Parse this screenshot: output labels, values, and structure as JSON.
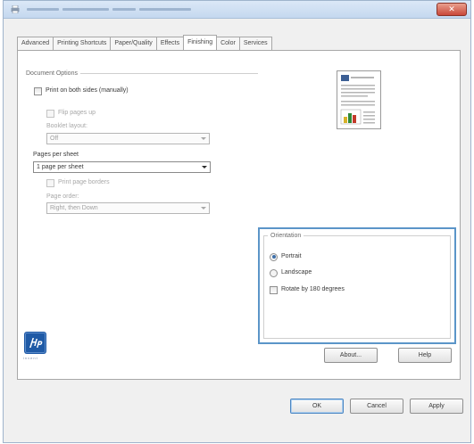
{
  "window": {
    "tabs": [
      {
        "label": "Advanced"
      },
      {
        "label": "Printing Shortcuts"
      },
      {
        "label": "Paper/Quality"
      },
      {
        "label": "Effects"
      },
      {
        "label": "Finishing"
      },
      {
        "label": "Color"
      },
      {
        "label": "Services"
      }
    ],
    "active_tab": "Finishing"
  },
  "document_options": {
    "legend": "Document Options",
    "print_both_sides": "Print on both sides (manually)",
    "flip_pages_up": "Flip pages up",
    "booklet_layout_label": "Booklet layout:",
    "booklet_layout_value": "Off",
    "pages_per_sheet_label": "Pages per sheet",
    "pages_per_sheet_value": "1 page per sheet",
    "print_page_borders": "Print page borders",
    "page_order_label": "Page order:",
    "page_order_value": "Right, then Down"
  },
  "orientation": {
    "legend": "Orientation",
    "portrait": "Portrait",
    "landscape": "Landscape",
    "rotate": "Rotate by 180 degrees",
    "selected": "portrait"
  },
  "buttons": {
    "about": "About...",
    "help": "Help",
    "ok": "OK",
    "cancel": "Cancel",
    "apply": "Apply"
  },
  "brand": {
    "tagline": "invent"
  },
  "colors": {
    "accent": "#5b95c8",
    "hp_blue": "#1f5aa6"
  }
}
